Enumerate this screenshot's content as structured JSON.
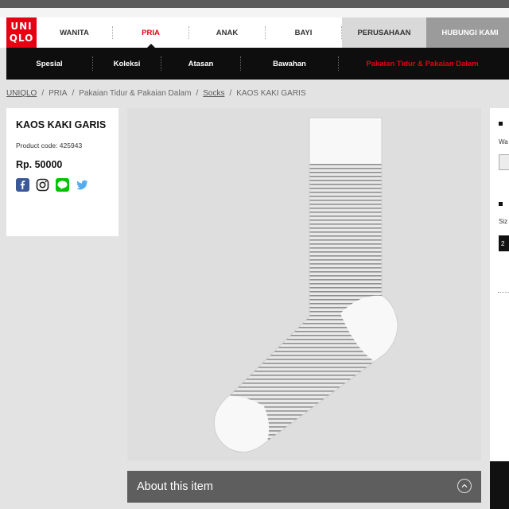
{
  "brand": {
    "logo_top": "UNI",
    "logo_bottom": "QLO",
    "color": "#e60012"
  },
  "nav_primary": [
    {
      "label": "WANITA"
    },
    {
      "label": "PRIA",
      "active": true
    },
    {
      "label": "ANAK"
    },
    {
      "label": "BAYI"
    },
    {
      "label": "PERUSAHAAN"
    },
    {
      "label": "HUBUNGI KAMI"
    }
  ],
  "nav_secondary": [
    {
      "label": "Spesial"
    },
    {
      "label": "Koleksi"
    },
    {
      "label": "Atasan"
    },
    {
      "label": "Bawahan"
    },
    {
      "label": "Pakaian Tidur & Pakaian Dalam",
      "highlight": true
    }
  ],
  "breadcrumb": {
    "items": [
      "UNIQLO",
      "PRIA",
      "Pakaian Tidur & Pakaian Dalam",
      "Socks",
      "KAOS KAKI GARIS"
    ],
    "separator": "/"
  },
  "product": {
    "title": "KAOS KAKI GARIS",
    "code_label": "Product code: 425943",
    "price": "Rp. 50000"
  },
  "social_icons": [
    "facebook-icon",
    "instagram-icon",
    "line-icon",
    "twitter-icon"
  ],
  "about": {
    "label": "About this item"
  },
  "side_panel": {
    "label1": "Wa",
    "label2": "Siz",
    "size_value": "2"
  }
}
